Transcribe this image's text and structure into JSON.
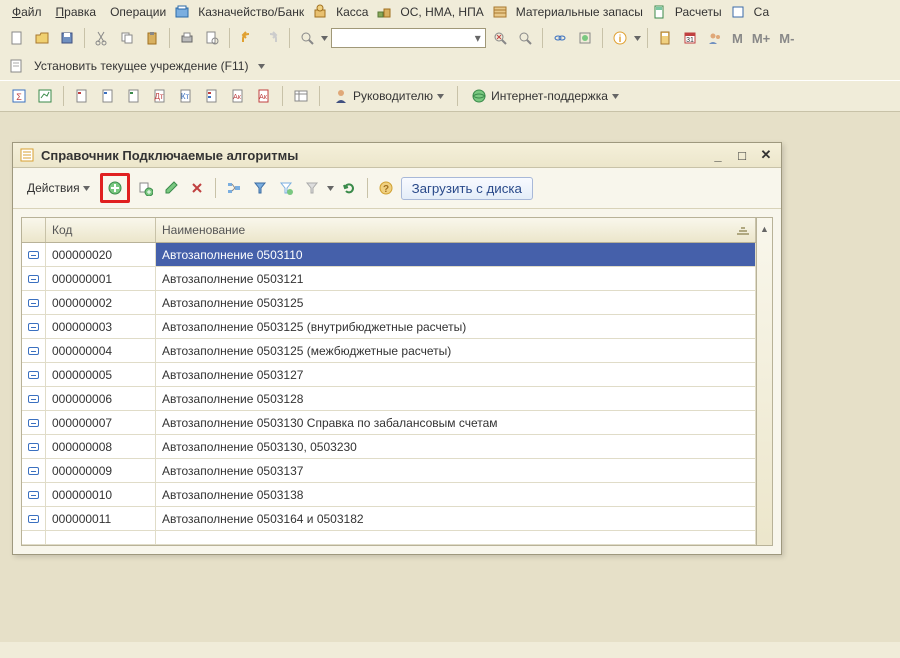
{
  "menubar": {
    "file": "Файл",
    "edit": "Правка",
    "operations": "Операции",
    "treasury": "Казначейство/Банк",
    "cashdesk": "Касса",
    "fixed_assets": "ОС, НМА, НПА",
    "materials": "Материальные запасы",
    "calculations": "Расчеты",
    "more": "Са"
  },
  "sub_toolbar": {
    "set_institution": "Установить текущее учреждение (F11)"
  },
  "toolbar_links": {
    "manager": "Руководителю",
    "internet": "Интернет-поддержка"
  },
  "m_labels": {
    "m": "M",
    "mplus": "M+",
    "mminus": "M-"
  },
  "window": {
    "title": "Справочник Подключаемые алгоритмы",
    "actions": "Действия",
    "load_from_disk": "Загрузить с диска"
  },
  "grid": {
    "col_code": "Код",
    "col_name": "Наименование",
    "rows": [
      {
        "code": "000000020",
        "name": "Автозаполнение 0503110"
      },
      {
        "code": "000000001",
        "name": "Автозаполнение 0503121"
      },
      {
        "code": "000000002",
        "name": "Автозаполнение 0503125"
      },
      {
        "code": "000000003",
        "name": "Автозаполнение 0503125 (внутрибюджетные расчеты)"
      },
      {
        "code": "000000004",
        "name": "Автозаполнение 0503125 (межбюджетные расчеты)"
      },
      {
        "code": "000000005",
        "name": "Автозаполнение 0503127"
      },
      {
        "code": "000000006",
        "name": "Автозаполнение 0503128"
      },
      {
        "code": "000000007",
        "name": "Автозаполнение 0503130 Справка по забалансовым счетам"
      },
      {
        "code": "000000008",
        "name": "Автозаполнение 0503130, 0503230"
      },
      {
        "code": "000000009",
        "name": "Автозаполнение 0503137"
      },
      {
        "code": "000000010",
        "name": "Автозаполнение 0503138"
      },
      {
        "code": "000000011",
        "name": "Автозаполнение 0503164 и 0503182"
      }
    ]
  }
}
